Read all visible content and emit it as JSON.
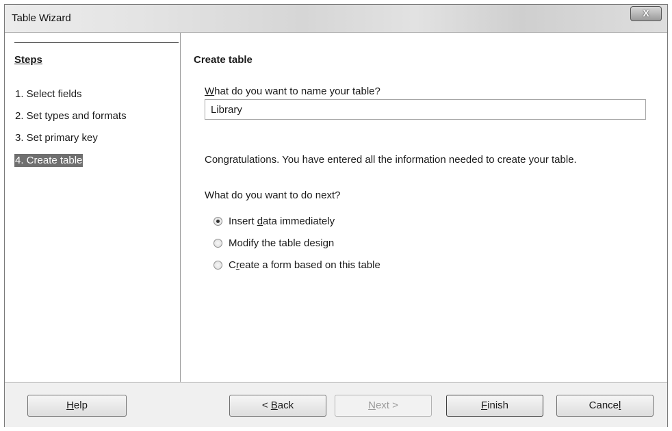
{
  "window": {
    "title": "Table Wizard",
    "close_label": "X"
  },
  "sidebar": {
    "heading": "Steps",
    "items": [
      {
        "label": "1. Select fields",
        "active": false
      },
      {
        "label": "2. Set types and formats",
        "active": false
      },
      {
        "label": "3. Set primary key",
        "active": false
      },
      {
        "label": "4. Create table",
        "active": true
      }
    ]
  },
  "main": {
    "title": "Create table",
    "name_question": {
      "mnemonic": "W",
      "rest": "hat do you want to name your table?"
    },
    "table_name": "Library",
    "congrats": "Congratulations. You have entered all the information needed to create your table.",
    "next_question": "What do you want to do next?",
    "options": [
      {
        "pre": "Insert ",
        "mnemonic": "d",
        "post": "ata immediately",
        "checked": true
      },
      {
        "pre": "Modify the table desi",
        "mnemonic": "g",
        "post": "n",
        "checked": false
      },
      {
        "pre": "C",
        "mnemonic": "r",
        "post": "eate a form based on this table",
        "checked": false
      }
    ]
  },
  "buttons": {
    "help": {
      "pre": "",
      "mnemonic": "H",
      "post": "elp"
    },
    "back": {
      "pre": "< ",
      "mnemonic": "B",
      "post": "ack"
    },
    "next": {
      "pre": "",
      "mnemonic": "N",
      "post": "ext >"
    },
    "finish": {
      "pre": "",
      "mnemonic": "F",
      "post": "inish"
    },
    "cancel": {
      "pre": "Cance",
      "mnemonic": "l",
      "post": ""
    }
  }
}
